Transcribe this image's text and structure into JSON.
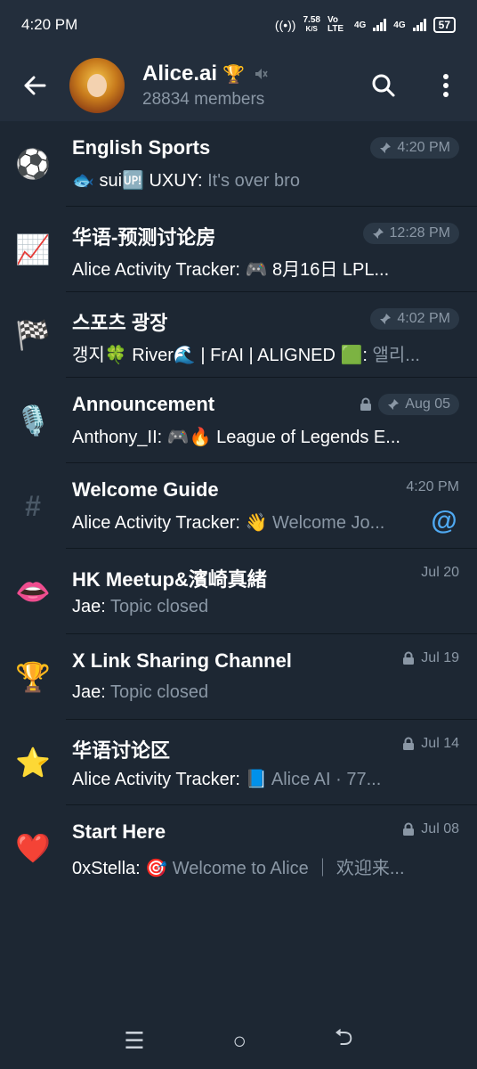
{
  "statusbar": {
    "time": "4:20 PM",
    "speed": "7.58",
    "speed_unit": "K/S",
    "volte": "Vo LTE",
    "net1": "4G",
    "net2": "4G",
    "battery": "57"
  },
  "header": {
    "title": "Alice.ai",
    "title_emoji": "🏆",
    "members": "28834 members",
    "icons": [
      "back-arrow-icon",
      "search-icon",
      "more-vertical-icon",
      "mute-icon"
    ]
  },
  "topics": [
    {
      "icon": "⚽",
      "name": "English Sports",
      "time": "4:20 PM",
      "pinned": true,
      "locked": false,
      "sender": "🐟 sui🆙 UXUY:",
      "message": "It's over bro"
    },
    {
      "icon": "📈",
      "name": "华语-预测讨论房",
      "time": "12:28 PM",
      "pinned": true,
      "locked": false,
      "sender": "Alice Activity Tracker: 🎮 8月16日 LPL...",
      "message": ""
    },
    {
      "icon": "🏁",
      "name": "스포츠 광장",
      "time": "4:02 PM",
      "pinned": true,
      "locked": false,
      "sender": "갱지🍀 River🌊 | FrAI | ALIGNED 🟩:",
      "message": "앨리..."
    },
    {
      "icon": "🎙️",
      "name": "Announcement",
      "time": "Aug 05",
      "pinned": true,
      "locked": true,
      "sender": "Anthony_II: 🎮🔥 League of Legends E...",
      "message": ""
    },
    {
      "icon": "#",
      "name": "Welcome Guide",
      "time": "4:20 PM",
      "pinned": false,
      "locked": false,
      "sender": "Alice Activity Tracker: 👋",
      "message": "Welcome Jo...",
      "mention": "@"
    },
    {
      "icon": "👄",
      "name": "HK Meetup&濱崎真緒",
      "time": "Jul 20",
      "pinned": false,
      "locked": false,
      "sender": "Jae:",
      "message": "Topic closed"
    },
    {
      "icon": "🏆",
      "name": "X Link Sharing Channel",
      "time": "Jul 19",
      "pinned": false,
      "locked": true,
      "sender": "Jae:",
      "message": "Topic closed"
    },
    {
      "icon": "⭐",
      "name": "华语讨论区",
      "time": "Jul 14",
      "pinned": false,
      "locked": true,
      "sender": "Alice Activity Tracker: 📘",
      "message": "Alice AI · 77..."
    },
    {
      "icon": "❤️",
      "name": "Start Here",
      "time": "Jul 08",
      "pinned": false,
      "locked": true,
      "sender": "0xStella: 🎯",
      "message": "Welcome to Alice ｜ 欢迎来..."
    }
  ],
  "navbar": {
    "recents": "☰",
    "home": "○",
    "back": "⮌"
  }
}
